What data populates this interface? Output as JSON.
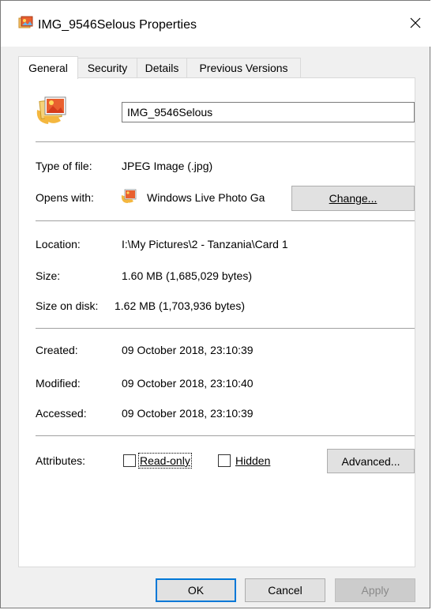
{
  "window": {
    "title": "IMG_9546Selous Properties"
  },
  "tabs": [
    {
      "label": "General",
      "active": true
    },
    {
      "label": "Security",
      "active": false
    },
    {
      "label": "Details",
      "active": false
    },
    {
      "label": "Previous Versions",
      "active": false
    }
  ],
  "general": {
    "filename": "IMG_9546Selous",
    "type_label": "Type of file:",
    "type_value": "JPEG Image (.jpg)",
    "opens_label": "Opens with:",
    "opens_value": "Windows Live Photo Ga",
    "change_label": "Change...",
    "location_label": "Location:",
    "location_value": "I:\\My Pictures\\2 - Tanzania\\Card 1",
    "size_label": "Size:",
    "size_value": "1.60 MB (1,685,029 bytes)",
    "disk_label": "Size on disk:",
    "disk_value": "1.62 MB (1,703,936 bytes)",
    "created_label": "Created:",
    "created_value": "09 October 2018, 23:10:39",
    "modified_label": "Modified:",
    "modified_value": "09 October 2018, 23:10:40",
    "accessed_label": "Accessed:",
    "accessed_value": "09 October 2018, 23:10:39",
    "attributes_label": "Attributes:",
    "readonly_label": "Read-only",
    "readonly_checked": false,
    "hidden_label": "Hidden",
    "hidden_checked": false,
    "advanced_label": "Advanced..."
  },
  "footer": {
    "ok_label": "OK",
    "cancel_label": "Cancel",
    "apply_label": "Apply"
  },
  "colors": {
    "accent": "#0078d7",
    "panel_bg": "#ffffff",
    "window_bg": "#f0f0f0"
  },
  "icons": {
    "title": "image-file-icon",
    "file": "photo-file-icon",
    "app": "photo-gallery-icon",
    "close": "close-icon"
  }
}
